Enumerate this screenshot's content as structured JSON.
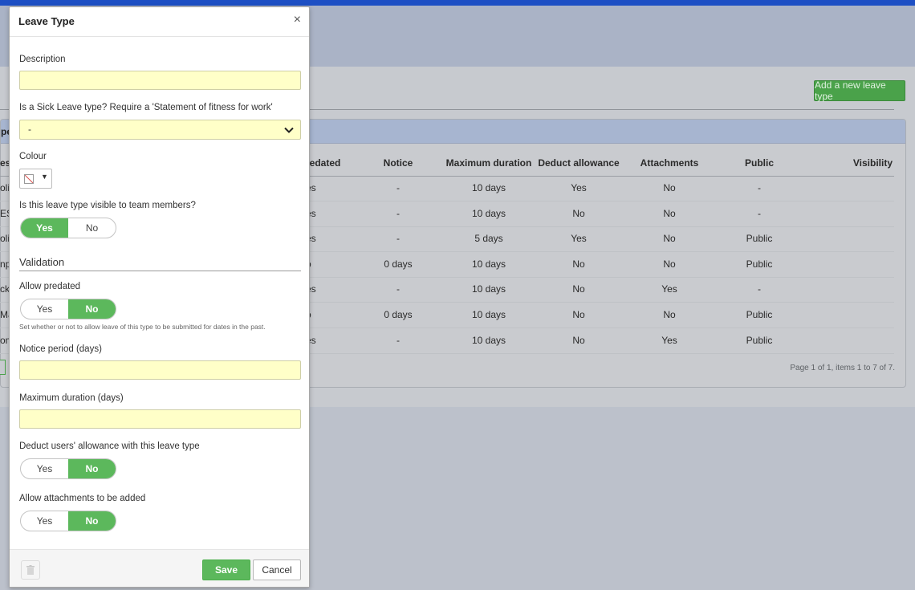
{
  "background": {
    "add_button_label": "Add a new leave type",
    "panel_title_fragment": "pe",
    "columns": [
      "es",
      "redated",
      "Notice",
      "Maximum duration",
      "Deduct allowance",
      "Attachments",
      "Public",
      "Visibility"
    ],
    "rows": [
      {
        "name": "oli",
        "predated": "es",
        "notice": "-",
        "max": "10 days",
        "deduct": "Yes",
        "attach": "No",
        "public": "-"
      },
      {
        "name": "ES",
        "predated": "es",
        "notice": "-",
        "max": "10 days",
        "deduct": "No",
        "attach": "No",
        "public": "-"
      },
      {
        "name": "oli",
        "predated": "es",
        "notice": "-",
        "max": "5 days",
        "deduct": "Yes",
        "attach": "No",
        "public": "Public"
      },
      {
        "name": "np",
        "predated": "o",
        "notice": "0 days",
        "max": "10 days",
        "deduct": "No",
        "attach": "No",
        "public": "Public"
      },
      {
        "name": "ck",
        "predated": "es",
        "notice": "-",
        "max": "10 days",
        "deduct": "No",
        "attach": "Yes",
        "public": "-"
      },
      {
        "name": "Mat",
        "predated": "o",
        "notice": "0 days",
        "max": "10 days",
        "deduct": "No",
        "attach": "No",
        "public": "Public"
      },
      {
        "name": "om",
        "predated": "es",
        "notice": "-",
        "max": "10 days",
        "deduct": "No",
        "attach": "Yes",
        "public": "Public"
      }
    ],
    "pager_text": "Page 1 of 1, items 1 to 7 of 7."
  },
  "modal": {
    "title": "Leave Type",
    "close_glyph": "×",
    "description_label": "Description",
    "description_value": "",
    "sick_label": "Is a Sick Leave type? Require a 'Statement of fitness for work'",
    "sick_value": "-",
    "colour_label": "Colour",
    "visible_label": "Is this leave type visible to team members?",
    "yes": "Yes",
    "no": "No",
    "validation_title": "Validation",
    "predated_label": "Allow predated",
    "predated_help": "Set whether or not to allow leave of this type to be submitted for dates in the past.",
    "notice_label": "Notice period (days)",
    "notice_value": "",
    "max_label": "Maximum duration (days)",
    "max_value": "",
    "deduct_label": "Deduct users' allowance with this leave type",
    "attach_label": "Allow attachments to be added",
    "save_label": "Save",
    "cancel_label": "Cancel",
    "toggles": {
      "visible": "Yes",
      "predated": "No",
      "deduct": "No",
      "attach": "No"
    }
  },
  "colors": {
    "accent_green": "#5cb85c",
    "input_yellow": "#ffffc8",
    "top_bar_blue": "#1d4fc4"
  },
  "icons": [
    "close-icon",
    "chevron-down-icon",
    "no-colour-swatch-icon",
    "caret-down-icon",
    "trash-icon"
  ]
}
